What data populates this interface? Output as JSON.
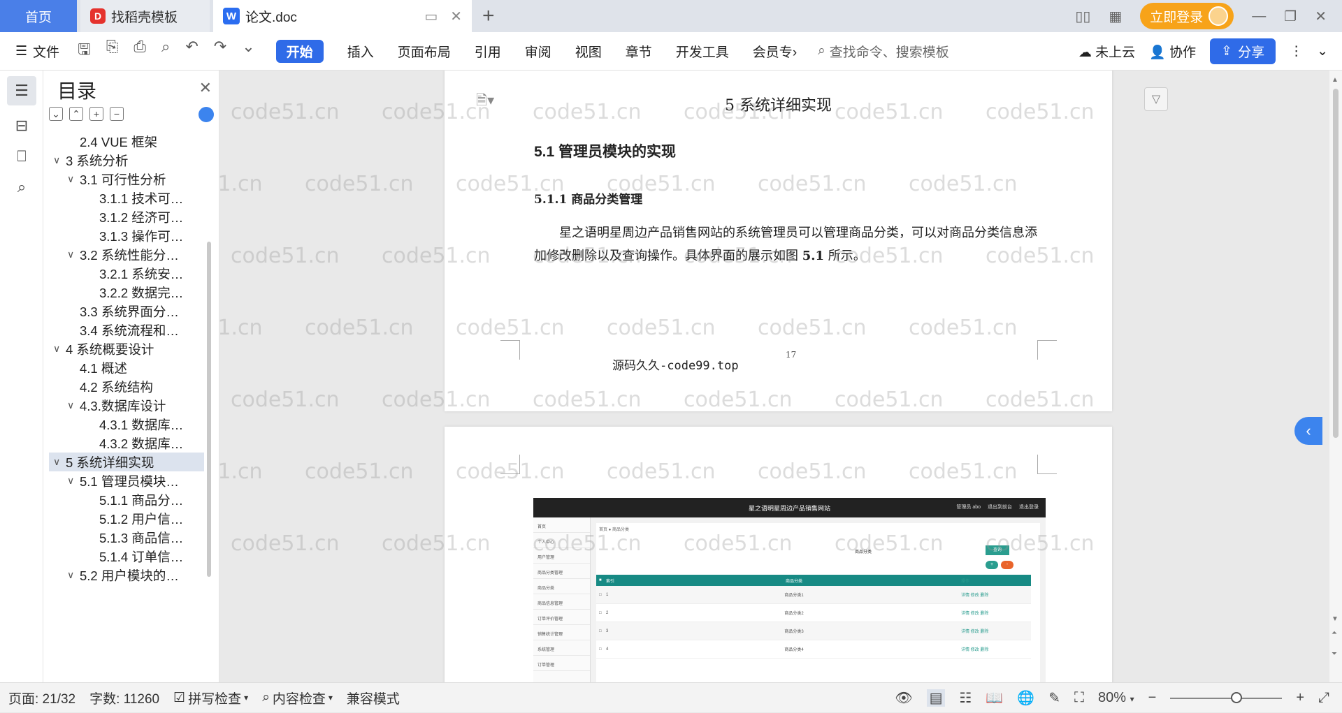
{
  "tabs": {
    "home": "首页",
    "templates": "找稻壳模板",
    "templates_logo": "D",
    "doc": "论文.doc",
    "doc_logo": "W",
    "new_tab": "+"
  },
  "window": {
    "login": "立即登录"
  },
  "toolbar": {
    "file": "文件",
    "start": "开始",
    "items": [
      "插入",
      "页面布局",
      "引用",
      "审阅",
      "视图",
      "章节",
      "开发工具",
      "会员专"
    ],
    "search_placeholder": "查找命令、搜索模板",
    "cloud": "未上云",
    "collab": "协作",
    "share": "分享"
  },
  "toc": {
    "title": "目录",
    "items": [
      {
        "label": "2.4 VUE 框架",
        "level": 2,
        "arrow": ""
      },
      {
        "label": "3 系统分析",
        "level": 1,
        "arrow": "∨"
      },
      {
        "label": "3.1 可行性分析",
        "level": 2,
        "arrow": "∨"
      },
      {
        "label": "3.1.1 技术可…",
        "level": 3,
        "arrow": ""
      },
      {
        "label": "3.1.2 经济可…",
        "level": 3,
        "arrow": ""
      },
      {
        "label": "3.1.3 操作可…",
        "level": 3,
        "arrow": ""
      },
      {
        "label": "3.2 系统性能分…",
        "level": 2,
        "arrow": "∨"
      },
      {
        "label": "3.2.1 系统安…",
        "level": 3,
        "arrow": ""
      },
      {
        "label": "3.2.2 数据完…",
        "level": 3,
        "arrow": ""
      },
      {
        "label": "3.3 系统界面分…",
        "level": 2,
        "arrow": ""
      },
      {
        "label": "3.4 系统流程和…",
        "level": 2,
        "arrow": ""
      },
      {
        "label": "4 系统概要设计",
        "level": 1,
        "arrow": "∨"
      },
      {
        "label": "4.1 概述",
        "level": 2,
        "arrow": ""
      },
      {
        "label": "4.2 系统结构",
        "level": 2,
        "arrow": ""
      },
      {
        "label": "4.3.数据库设计",
        "level": 2,
        "arrow": "∨"
      },
      {
        "label": "4.3.1 数据库…",
        "level": 3,
        "arrow": ""
      },
      {
        "label": "4.3.2 数据库…",
        "level": 3,
        "arrow": ""
      },
      {
        "label": "5 系统详细实现",
        "level": 1,
        "arrow": "∨",
        "active": true
      },
      {
        "label": "5.1 管理员模块…",
        "level": 2,
        "arrow": "∨"
      },
      {
        "label": "5.1.1 商品分…",
        "level": 3,
        "arrow": ""
      },
      {
        "label": "5.1.2 用户信…",
        "level": 3,
        "arrow": ""
      },
      {
        "label": "5.1.3 商品信…",
        "level": 3,
        "arrow": ""
      },
      {
        "label": "5.1.4 订单信…",
        "level": 3,
        "arrow": ""
      },
      {
        "label": "5.2 用户模块的…",
        "level": 2,
        "arrow": "∨"
      }
    ]
  },
  "doc": {
    "h1": "5 系统详细实现",
    "h2": "5.1  管理员模块的实现",
    "h3": "5.1.1  商品分类管理",
    "para_1": "星之语明星周边产品销售网站的系统管理员可以管理商品分类，可以对商品分类信息添加修改删除以及查询操作。具体界面的展示如图",
    "para_fig": "5.1",
    "para_2": "所示。",
    "footer": "源码久久-code99.top",
    "page_num": "17"
  },
  "screenshot": {
    "title": "星之语明星周边产品销售网站",
    "links": [
      "管理员 abo",
      "退出到前台",
      "退出登录"
    ],
    "side": [
      "首页",
      "个人中心",
      "用户管理",
      "商品分类管理",
      "商品分类",
      "商品信息管理",
      "订单评价管理",
      "销售统计管理",
      "系统管理",
      "订单管理"
    ],
    "crumb": "首页 ● 商品分类",
    "search_label": "商品分类",
    "search_btn": "查询",
    "add_btn": "+",
    "del_btn": "-",
    "headers": [
      "索引",
      "商品分类",
      "操作"
    ],
    "rows": [
      {
        "idx": "1",
        "name": "商品分类1",
        "ops": "详情 修改 删除"
      },
      {
        "idx": "2",
        "name": "商品分类2",
        "ops": "详情 修改 删除"
      },
      {
        "idx": "3",
        "name": "商品分类3",
        "ops": "详情 修改 删除"
      },
      {
        "idx": "4",
        "name": "商品分类4",
        "ops": "详情 修改 删除"
      }
    ]
  },
  "watermark": "code51.cn",
  "status": {
    "page": "页面: 21/32",
    "words": "字数: 11260",
    "spell": "拼写检查",
    "content": "内容检查",
    "compat": "兼容模式",
    "zoom": "80%",
    "zoom_level": 0.6
  }
}
